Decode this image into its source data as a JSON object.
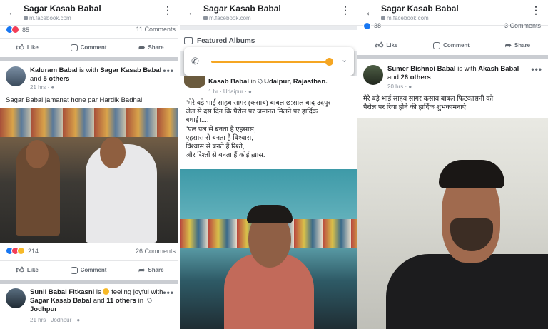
{
  "panels": [
    {
      "header": {
        "title": "Sagar Kasab Babal",
        "url": "m.facebook.com"
      },
      "top_bar": {
        "reactions": "85",
        "comments": "11 Comments"
      },
      "actions": {
        "like": "Like",
        "comment": "Comment",
        "share": "Share"
      },
      "post1": {
        "author": "Kaluram Babal",
        "is_with": "is with",
        "tag": "Sagar Kasab Babal",
        "and": "and",
        "others": "5 others",
        "time": "21 hrs",
        "text": "Sagar Babal jamanat hone par Hardik Badhai",
        "reactions": "214",
        "comments": "26 Comments"
      },
      "post2": {
        "author": "Sunil Babal Fitkasni",
        "feeling": "is",
        "feeling2": "feeling joyful",
        "with": "with",
        "tag": "Sagar Kasab Babal",
        "and": "and",
        "others": "11 others",
        "in": "in",
        "place": "Jodhpur",
        "time": "21 hrs",
        "location": "Jodhpur"
      }
    },
    {
      "header": {
        "title": "Sagar Kasab Babal",
        "url": "m.facebook.com"
      },
      "album_label": "Featured Albums",
      "post": {
        "author": "Kasab Babal",
        "in": "in",
        "place": "Udaipur, Rajasthan.",
        "time": "1 hr",
        "location": "Udaipur",
        "line1": "\"मेरे बड़े भाई साहब सागर (कसाब) बाबल छ:साल बाद उदपुर",
        "line2": "जेल से दस दिन कि पैरोल पर जमानत मिलने पर हार्दिक",
        "line3": "बधाई।....",
        "line4": "\"पल पल से बनता है एहसास,",
        "line5": "एहसास से बनता है विश्वास,",
        "line6": "विश्वास से बनते हैं रिश्ते,",
        "line7": "और रिश्तों से बनता हैं कोई ख़ास."
      },
      "colors": {
        "accent": "#f5a623"
      }
    },
    {
      "header": {
        "title": "Sagar Kasab Babal",
        "url": "m.facebook.com"
      },
      "top_bar": {
        "reactions": "38",
        "comments": "3 Comments"
      },
      "actions": {
        "like": "Like",
        "comment": "Comment",
        "share": "Share"
      },
      "post": {
        "author": "Sumer Bishnoi Babal",
        "is_with": "is with",
        "tag": "Akash Babal",
        "and": "and",
        "others": "26 others",
        "time": "20 hrs",
        "line1": "मेरे बड़े भाई साहब सागर कसाब बाबल फिटकासनी को",
        "line2": "पैरोल पर रिया होने की हार्दिक शुभकामनाएं"
      }
    }
  ],
  "icons": [
    "back-arrow-icon",
    "more-icon",
    "like-icon",
    "comment-icon",
    "share-icon",
    "globe-icon",
    "location-pin-icon",
    "phone-icon",
    "chevron-down-icon"
  ],
  "colors": {
    "facebook_blue": "#1877f2",
    "love_red": "#f33e58",
    "haha_yellow": "#f7b928"
  }
}
